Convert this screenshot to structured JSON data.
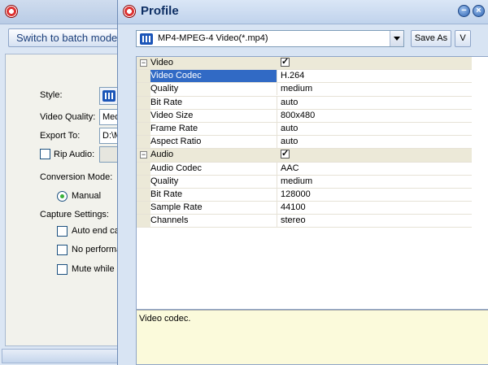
{
  "main_window": {
    "batch_button": "Switch to batch mode",
    "style_label": "Style:",
    "video_quality_label": "Video Quality:",
    "video_quality_value": "Med",
    "export_to_label": "Export To:",
    "export_to_value": "D:\\M",
    "rip_audio_label": "Rip Audio:",
    "conversion_mode_label": "Conversion Mode:",
    "manual_option": "Manual",
    "capture_settings_label": "Capture Settings:",
    "auto_end_label": "Auto end cap",
    "no_performance_label": "No performar",
    "mute_label": "Mute while c"
  },
  "profile_dialog": {
    "title": "Profile",
    "format": "MP4-MPEG-4 Video(*.mp4)",
    "save_as_label": "Save As",
    "v_button_label": "V",
    "minimize_icon": "minimize-icon",
    "close_icon": "close-icon",
    "description": "Video codec."
  },
  "properties": [
    {
      "type": "category",
      "name": "Video",
      "checked": true
    },
    {
      "type": "child",
      "name": "Video Codec",
      "value": "H.264",
      "selected": true
    },
    {
      "type": "child",
      "name": "Quality",
      "value": "medium"
    },
    {
      "type": "child",
      "name": "Bit Rate",
      "value": "auto"
    },
    {
      "type": "child",
      "name": "Video Size",
      "value": "800x480"
    },
    {
      "type": "child",
      "name": "Frame Rate",
      "value": "auto"
    },
    {
      "type": "child",
      "name": "Aspect Ratio",
      "value": "auto"
    },
    {
      "type": "category",
      "name": "Audio",
      "checked": true
    },
    {
      "type": "child",
      "name": "Audio Codec",
      "value": "AAC"
    },
    {
      "type": "child",
      "name": "Quality",
      "value": "medium"
    },
    {
      "type": "child",
      "name": "Bit Rate",
      "value": "128000"
    },
    {
      "type": "child",
      "name": "Sample Rate",
      "value": "44100"
    },
    {
      "type": "child",
      "name": "Channels",
      "value": "stereo"
    }
  ],
  "colors": {
    "selection": "#316ac5",
    "category_bg": "#ece9d8",
    "description_bg": "#fbfadb",
    "title_text": "#0e2f64"
  }
}
